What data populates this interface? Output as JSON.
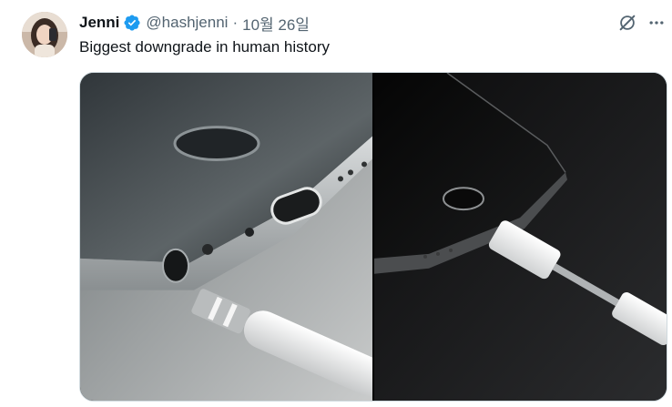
{
  "tweet": {
    "author_name": "Jenni",
    "handle": "@hashjenni",
    "separator": "·",
    "date": "10월 26일",
    "text": "Biggest downgrade in human history",
    "verified": true
  },
  "icons": {
    "verified": "verified-badge-icon",
    "grok": "grok-icon",
    "more": "more-icon"
  },
  "colors": {
    "verified": "#1d9bf0",
    "secondary_text": "#536471",
    "primary_text": "#0f1419"
  }
}
